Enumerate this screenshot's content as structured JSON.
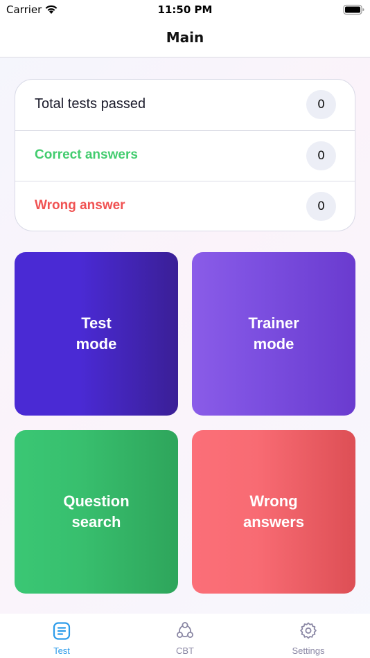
{
  "status_bar": {
    "carrier": "Carrier",
    "time": "11:50 PM"
  },
  "nav": {
    "title": "Main"
  },
  "stats": [
    {
      "label": "Total tests passed",
      "value": "0",
      "color": "#1b1b2b"
    },
    {
      "label": "Correct answers",
      "value": "0",
      "color": "#42cc6e"
    },
    {
      "label": "Wrong answer",
      "value": "0",
      "color": "#f05252"
    }
  ],
  "tiles": {
    "test_mode": "Test\nmode",
    "trainer_mode": "Trainer\nmode",
    "question_search": "Question\nsearch",
    "wrong_answers": "Wrong\nanswers"
  },
  "tab_bar": {
    "items": [
      {
        "label": "Test",
        "icon": "document-list-icon",
        "active": true
      },
      {
        "label": "CBT",
        "icon": "share-nodes-icon",
        "active": false
      },
      {
        "label": "Settings",
        "icon": "gear-icon",
        "active": false
      }
    ],
    "active_color": "#2b9bea",
    "inactive_color": "#8a87a4"
  }
}
